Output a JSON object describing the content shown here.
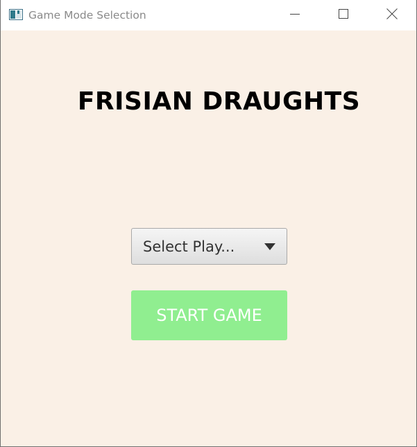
{
  "window": {
    "title": "Game Mode Selection",
    "controls": [
      "minimize",
      "maximize",
      "close"
    ]
  },
  "main": {
    "heading": "FRISIAN DRAUGHTS",
    "player_select": {
      "placeholder": "Select Play..."
    },
    "start_button_label": "START GAME"
  },
  "colors": {
    "background": "#faf0e6",
    "start_button": "#90ee90",
    "start_button_text": "#ffffff"
  },
  "icons": {
    "app": "java-app-icon",
    "minimize": "minimize-icon",
    "maximize": "maximize-icon",
    "close": "close-icon",
    "dropdown": "chevron-down-icon"
  }
}
